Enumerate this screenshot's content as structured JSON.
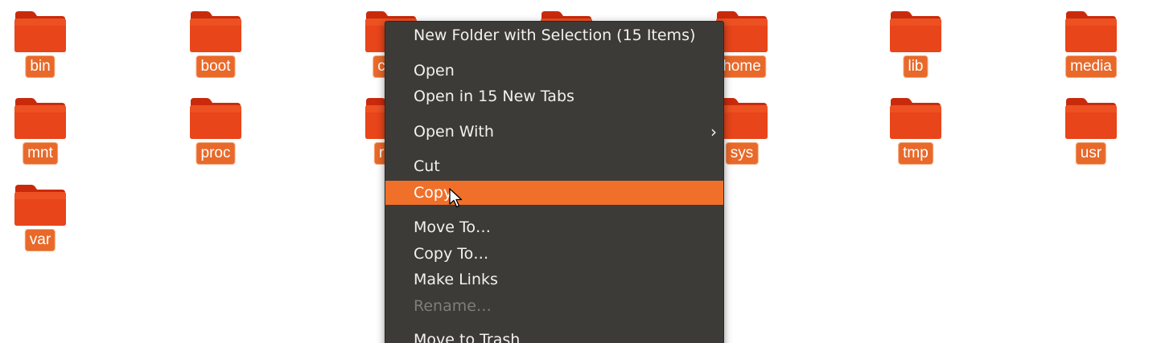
{
  "desktop": {
    "folder_color": "#e8451a",
    "label_color": "#e8692a",
    "folders": [
      {
        "label": "bin"
      },
      {
        "label": "boot"
      },
      {
        "label": "c"
      },
      {
        "label": ""
      },
      {
        "label": "home"
      },
      {
        "label": "lib"
      },
      {
        "label": "media"
      },
      {
        "label": "mnt"
      },
      {
        "label": "proc"
      },
      {
        "label": "r"
      },
      {
        "label": "sys"
      },
      {
        "label": "tmp"
      },
      {
        "label": "usr"
      },
      {
        "label": "var"
      }
    ]
  },
  "context_menu": {
    "background": "#3c3b37",
    "highlight_color": "#f0702a",
    "items": [
      {
        "label": "New Folder with Selection (15 Items)",
        "state": "normal"
      },
      {
        "label": "Open",
        "state": "normal"
      },
      {
        "label": "Open in 15 New Tabs",
        "state": "normal"
      },
      {
        "label": "Open With",
        "state": "normal",
        "submenu_arrow": "›"
      },
      {
        "label": "Cut",
        "state": "normal"
      },
      {
        "label": "Copy",
        "state": "highlighted"
      },
      {
        "label": "Move To…",
        "state": "normal"
      },
      {
        "label": "Copy To…",
        "state": "normal"
      },
      {
        "label": "Make Links",
        "state": "normal"
      },
      {
        "label": "Rename…",
        "state": "disabled"
      },
      {
        "label": "Move to Trash",
        "state": "normal"
      }
    ]
  },
  "cursor": {
    "icon": "arrow-pointer-icon"
  }
}
